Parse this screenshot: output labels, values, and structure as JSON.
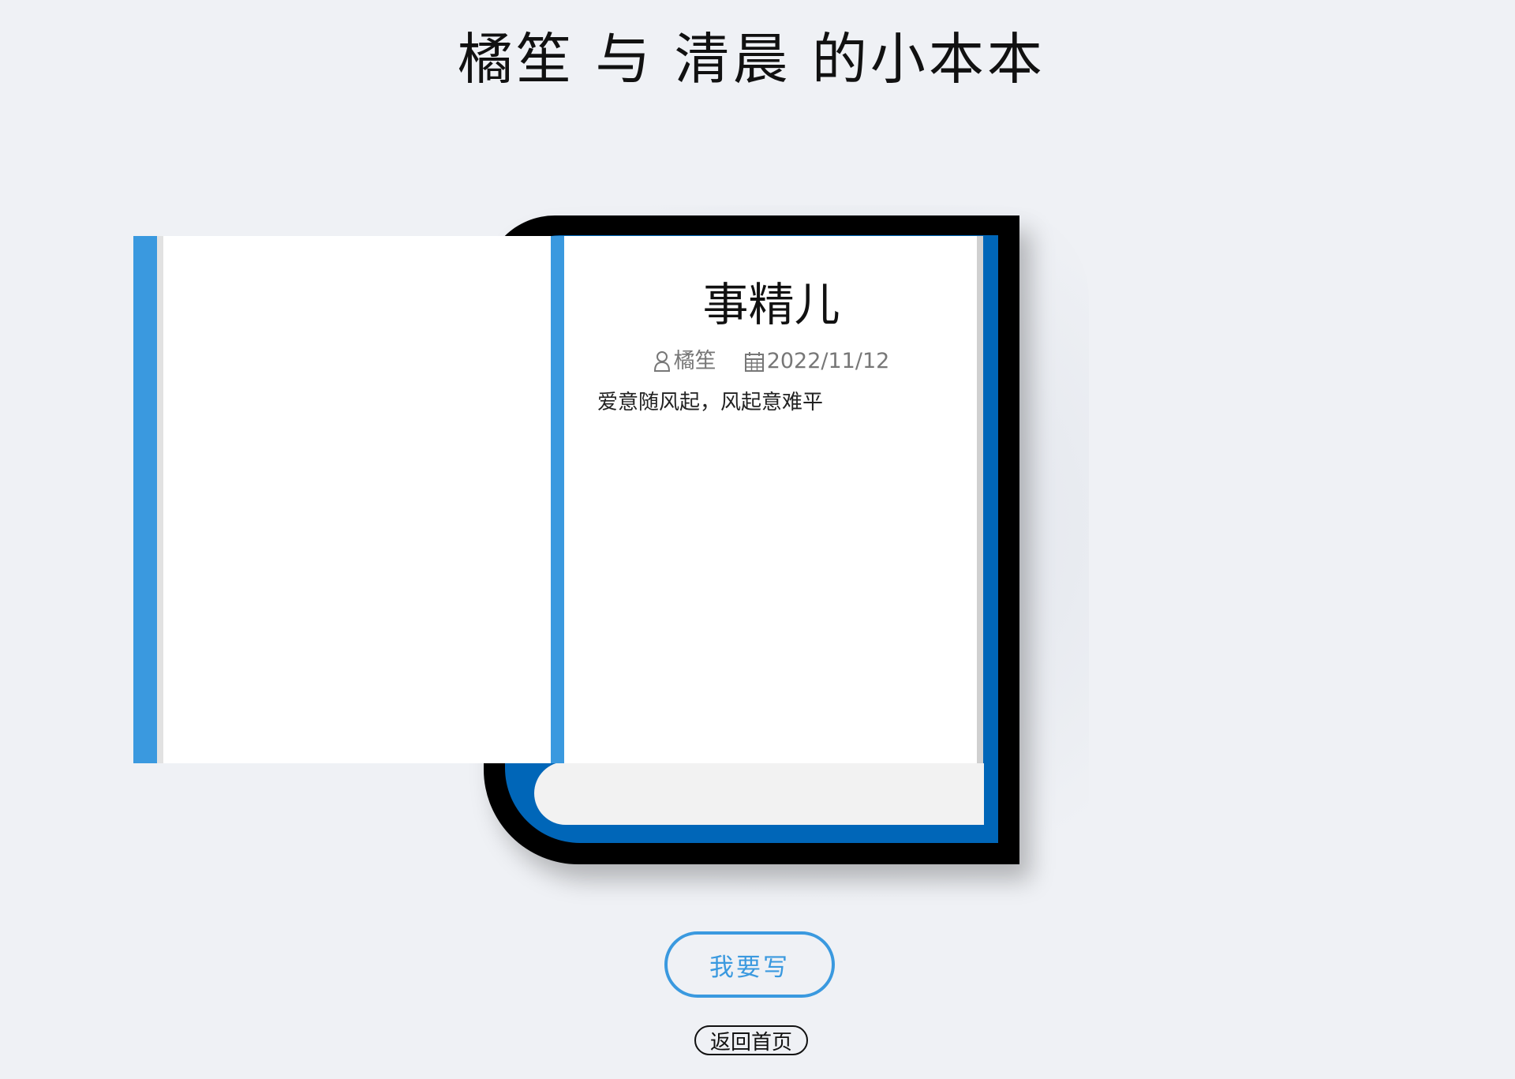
{
  "site": {
    "title": "橘笙 与 清晨 的小本本"
  },
  "post": {
    "title": "事精儿",
    "author": "橘笙",
    "date": "2022/11/12",
    "body": "爱意随风起，风起意难平"
  },
  "icons": {
    "author": "user-icon",
    "date": "calendar-icon"
  },
  "actions": {
    "write_label": "我要写",
    "home_label": "返回首页"
  },
  "colors": {
    "accent": "#3a99df",
    "cover": "#0066b8",
    "cover_back": "#000000",
    "background": "#eff1f5"
  }
}
